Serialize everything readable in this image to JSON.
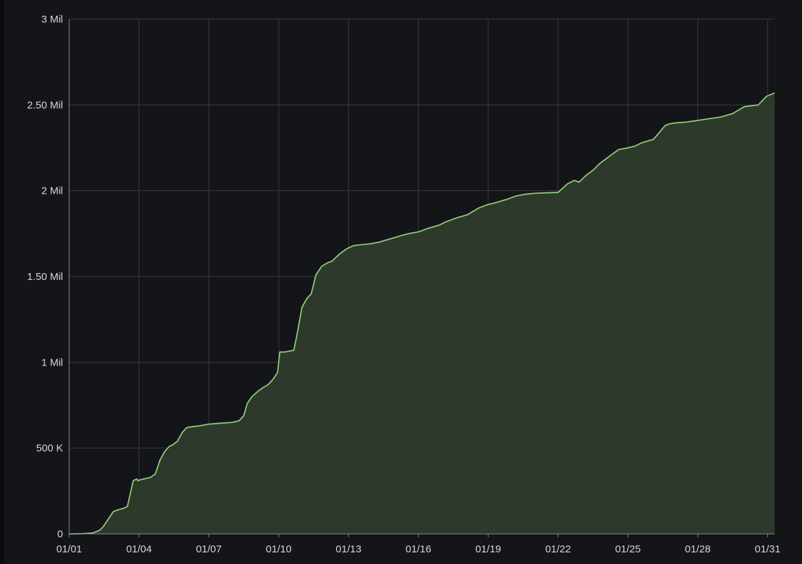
{
  "chart_data": {
    "type": "area",
    "title": "",
    "xlabel": "",
    "ylabel": "",
    "ylim": [
      0,
      3000000
    ],
    "y_ticks": [
      {
        "value": 0,
        "label": "0"
      },
      {
        "value": 500000,
        "label": "500 K"
      },
      {
        "value": 1000000,
        "label": "1 Mil"
      },
      {
        "value": 1500000,
        "label": "1.50 Mil"
      },
      {
        "value": 2000000,
        "label": "2 Mil"
      },
      {
        "value": 2500000,
        "label": "2.50 Mil"
      },
      {
        "value": 3000000,
        "label": "3 Mil"
      }
    ],
    "xlim": [
      1,
      31.3
    ],
    "x_ticks": [
      {
        "value": 1,
        "label": "01/01"
      },
      {
        "value": 4,
        "label": "01/04"
      },
      {
        "value": 7,
        "label": "01/07"
      },
      {
        "value": 10,
        "label": "01/10"
      },
      {
        "value": 13,
        "label": "01/13"
      },
      {
        "value": 16,
        "label": "01/16"
      },
      {
        "value": 19,
        "label": "01/19"
      },
      {
        "value": 22,
        "label": "01/22"
      },
      {
        "value": 25,
        "label": "01/25"
      },
      {
        "value": 28,
        "label": "01/28"
      },
      {
        "value": 31,
        "label": "01/31"
      }
    ],
    "grid": true,
    "legend": "none",
    "colors": {
      "background": "#141519",
      "grid": "#3a3c42",
      "line": "#8fcc7a",
      "fill": "#2d3a2b",
      "tick_text": "#d6d7da"
    },
    "series": [
      {
        "x": [
          1.0,
          1.6,
          2.0,
          2.3,
          2.45,
          2.6,
          2.75,
          2.9,
          3.1,
          3.35,
          3.5,
          3.75,
          3.9,
          3.95,
          4.05,
          4.2,
          4.5,
          4.7,
          4.9,
          5.1,
          5.3,
          5.45,
          5.65,
          5.85,
          6.05,
          6.3,
          6.6,
          7.0,
          7.5,
          8.0,
          8.3,
          8.5,
          8.65,
          8.85,
          9.1,
          9.3,
          9.55,
          9.75,
          9.95,
          10.05,
          10.25,
          10.65,
          10.8,
          11.0,
          11.2,
          11.4,
          11.6,
          11.85,
          12.1,
          12.3,
          12.6,
          12.9,
          13.2,
          13.5,
          13.9,
          14.3,
          14.8,
          15.3,
          15.6,
          16.0,
          16.4,
          16.9,
          17.2,
          17.6,
          18.1,
          18.6,
          19.0,
          19.3,
          19.8,
          20.2,
          20.6,
          21.0,
          21.5,
          22.0,
          22.4,
          22.7,
          22.9,
          23.2,
          23.5,
          23.8,
          24.2,
          24.6,
          25.0,
          25.3,
          25.6,
          26.1,
          26.6,
          26.8,
          27.0,
          27.5,
          28.0,
          28.5,
          29.0,
          29.5,
          30.0,
          30.6,
          30.95,
          31.3
        ],
        "y": [
          0,
          1000,
          5000,
          20000,
          40000,
          70000,
          100000,
          130000,
          140000,
          150000,
          160000,
          310000,
          320000,
          310000,
          315000,
          320000,
          330000,
          350000,
          430000,
          480000,
          510000,
          520000,
          540000,
          590000,
          620000,
          625000,
          630000,
          640000,
          645000,
          650000,
          660000,
          690000,
          760000,
          800000,
          830000,
          850000,
          870000,
          900000,
          940000,
          1060000,
          1060000,
          1070000,
          1170000,
          1320000,
          1370000,
          1400000,
          1510000,
          1560000,
          1580000,
          1590000,
          1630000,
          1660000,
          1680000,
          1685000,
          1690000,
          1700000,
          1720000,
          1740000,
          1750000,
          1760000,
          1780000,
          1800000,
          1820000,
          1840000,
          1860000,
          1900000,
          1920000,
          1930000,
          1950000,
          1970000,
          1980000,
          1985000,
          1988000,
          1990000,
          2040000,
          2060000,
          2050000,
          2090000,
          2120000,
          2160000,
          2200000,
          2240000,
          2250000,
          2260000,
          2280000,
          2300000,
          2380000,
          2390000,
          2395000,
          2400000,
          2410000,
          2420000,
          2430000,
          2450000,
          2490000,
          2500000,
          2550000,
          2570000
        ]
      }
    ]
  }
}
